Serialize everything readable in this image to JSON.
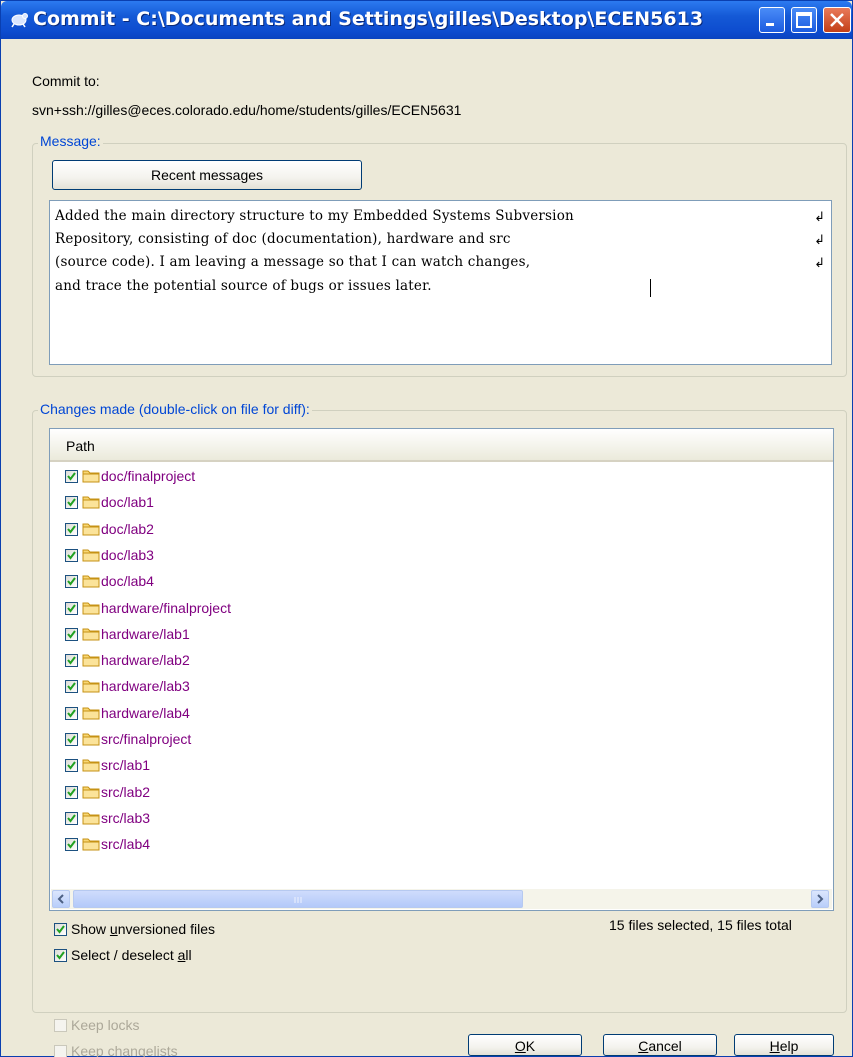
{
  "window": {
    "title": "Commit - C:\\Documents and Settings\\gilles\\Desktop\\ECEN5613"
  },
  "commit_to": {
    "label": "Commit to:",
    "url": "svn+ssh://gilles@eces.colorado.edu/home/students/gilles/ECEN5631"
  },
  "message_group": {
    "label": "Message:",
    "recent_button": "Recent messages",
    "lines": [
      "Added the main directory structure to my Embedded Systems Subversion",
      "Repository, consisting of doc (documentation), hardware and src",
      "(source code).  I am leaving a message so that I can watch changes,",
      "and trace the potential source of bugs or issues later."
    ],
    "wrap_marker": "↲"
  },
  "changes_group": {
    "label": "Changes made (double-click on file for diff):",
    "column_header": "Path",
    "files": [
      {
        "path": "doc/finalproject",
        "checked": true
      },
      {
        "path": "doc/lab1",
        "checked": true
      },
      {
        "path": "doc/lab2",
        "checked": true
      },
      {
        "path": "doc/lab3",
        "checked": true
      },
      {
        "path": "doc/lab4",
        "checked": true
      },
      {
        "path": "hardware/finalproject",
        "checked": true
      },
      {
        "path": "hardware/lab1",
        "checked": true
      },
      {
        "path": "hardware/lab2",
        "checked": true
      },
      {
        "path": "hardware/lab3",
        "checked": true
      },
      {
        "path": "hardware/lab4",
        "checked": true
      },
      {
        "path": "src/finalproject",
        "checked": true
      },
      {
        "path": "src/lab1",
        "checked": true
      },
      {
        "path": "src/lab2",
        "checked": true
      },
      {
        "path": "src/lab3",
        "checked": true
      },
      {
        "path": "src/lab4",
        "checked": true
      }
    ],
    "scroll_left_icon": "arrow-left-icon",
    "scroll_right_icon": "arrow-right-icon",
    "show_unversioned_pre": "Show ",
    "show_unversioned_key": "u",
    "show_unversioned_post": "nversioned files",
    "select_all_pre": "Select / deselect ",
    "select_all_key": "a",
    "select_all_post": "ll",
    "status": "15 files selected, 15 files total"
  },
  "options": {
    "keep_locks": "Keep locks",
    "keep_changelists": "Keep changelists"
  },
  "buttons": {
    "ok_key": "O",
    "ok_rest": "K",
    "cancel_key": "C",
    "cancel_rest": "ancel",
    "help_key": "H",
    "help_rest": "elp"
  },
  "colors": {
    "titlebar": "#0d4ccf",
    "group_label": "#0046d5",
    "path_text": "#800080",
    "checkbox_check": "#21a121"
  }
}
